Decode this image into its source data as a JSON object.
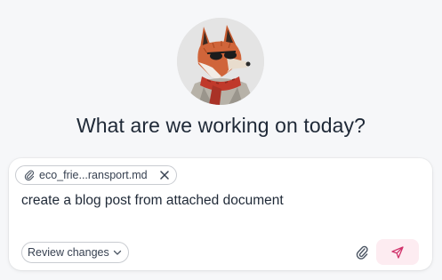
{
  "assistant": {
    "avatar_icon": "fox-avatar-icon",
    "headline": "What are we working on today?"
  },
  "composer": {
    "attachment": {
      "filename": "eco_frie...ransport.md",
      "icon": "paperclip-icon",
      "remove_icon": "close-icon"
    },
    "prompt_text": "create a blog post from attached document",
    "mode_selector": {
      "label": "Review changes",
      "icon": "chevron-down-icon"
    },
    "attach_icon": "paperclip-icon",
    "send_icon": "send-icon"
  },
  "colors": {
    "background": "#f6f7f9",
    "composer_bg": "#ffffff",
    "send_button_bg": "#fdecf1",
    "send_icon": "#d1336b",
    "text": "#1f2937",
    "fox_orange": "#d0653a",
    "scarf_red": "#c0392b"
  }
}
